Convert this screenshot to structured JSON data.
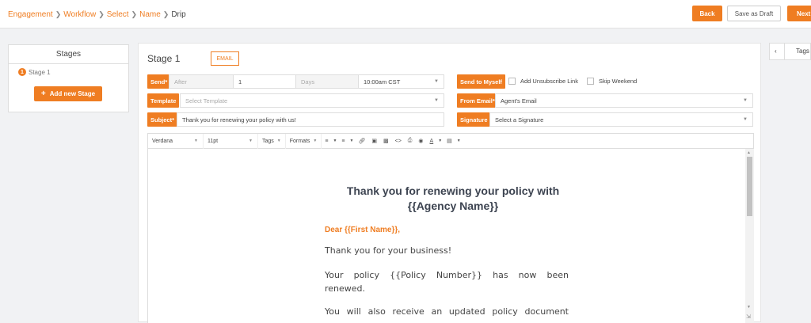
{
  "breadcrumb": {
    "items": [
      "Engagement",
      "Workflow",
      "Select",
      "Name"
    ],
    "current": "Drip"
  },
  "header": {
    "back_label": "Back",
    "draft_label": "Save as Draft",
    "next_label": "Next"
  },
  "stages": {
    "title": "Stages",
    "items": [
      {
        "number": "1",
        "label": "Stage 1"
      }
    ],
    "add_label": "Add new Stage"
  },
  "stage": {
    "title": "Stage 1",
    "type_tag": "EMAIL"
  },
  "form": {
    "send_label": "Send*",
    "after_text": "After",
    "after_value": "1",
    "unit_text": "Days",
    "time_value": "10:00am CST",
    "send_to_myself_label": "Send to Myself",
    "unsubscribe_label": "Add Unsubscribe Link",
    "skip_weekend_label": "Skip Weekend",
    "template_label": "Template",
    "template_placeholder": "Select Template",
    "from_email_label": "From Email*",
    "from_email_value": "Agent's Email",
    "subject_label": "Subject*",
    "subject_value": "Thank you for renewing your policy with us!",
    "signature_label": "Signature",
    "signature_value": "Select a Signature"
  },
  "toolbar": {
    "font": "Verdana",
    "size": "11pt",
    "tags": "Tags",
    "formats": "Formats"
  },
  "email_body": {
    "heading_line1": "Thank you for renewing your policy with",
    "heading_line2": "{{Agency Name}}",
    "greeting": "Dear {{First Name}},",
    "para1": "Thank you for your business!",
    "para2_line1": "Your policy {{Policy Number}} has now been",
    "para2_line2": "renewed.",
    "para3_partial": "You will also receive an updated policy document"
  },
  "side_panel": {
    "tags_label": "Tags"
  },
  "colors": {
    "accent": "#ef7d22",
    "heading": "#3d4451"
  },
  "icons": [
    "chevron-right-icon",
    "plus-icon",
    "chevron-down-icon",
    "bullet-list-icon",
    "numbered-list-icon",
    "link-icon",
    "image-icon",
    "media-icon",
    "code-icon",
    "print-icon",
    "preview-icon",
    "text-color-icon",
    "highlight-icon",
    "chevron-left-icon",
    "resize-icon"
  ]
}
